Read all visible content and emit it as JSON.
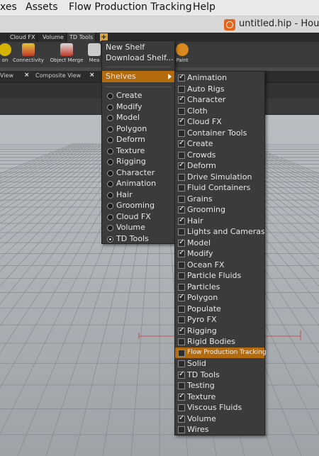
{
  "menubar": {
    "items": [
      "xes",
      "Assets",
      "Flow Production Tracking",
      "Help"
    ]
  },
  "window": {
    "title": "untitled.hip - Houc"
  },
  "shelf_tabs": [
    "",
    "Cloud FX",
    "Volume",
    "TD Tools",
    "+"
  ],
  "tools": [
    "on",
    "Connectivity",
    "Object Merge",
    "Mea",
    "Paint"
  ],
  "pane_tabs": [
    "View",
    "Composite View"
  ],
  "shelf_menu": {
    "new_shelf": "New Shelf",
    "download_shelf": "Download Shelf...",
    "shelves": "Shelves",
    "shelf_sets": [
      {
        "label": "Create",
        "selected": false
      },
      {
        "label": "Modify",
        "selected": false
      },
      {
        "label": "Model",
        "selected": false
      },
      {
        "label": "Polygon",
        "selected": false
      },
      {
        "label": "Deform",
        "selected": false
      },
      {
        "label": "Texture",
        "selected": false
      },
      {
        "label": "Rigging",
        "selected": false
      },
      {
        "label": "Character",
        "selected": false
      },
      {
        "label": "Animation",
        "selected": false
      },
      {
        "label": "Hair",
        "selected": false
      },
      {
        "label": "Grooming",
        "selected": false
      },
      {
        "label": "Cloud FX",
        "selected": false
      },
      {
        "label": "Volume",
        "selected": false
      },
      {
        "label": "TD Tools",
        "selected": true
      }
    ]
  },
  "shelves_submenu": [
    {
      "label": "Animation",
      "checked": true
    },
    {
      "label": "Auto Rigs",
      "checked": false
    },
    {
      "label": "Character",
      "checked": true
    },
    {
      "label": "Cloth",
      "checked": false
    },
    {
      "label": "Cloud FX",
      "checked": true
    },
    {
      "label": "Container Tools",
      "checked": false
    },
    {
      "label": "Create",
      "checked": true
    },
    {
      "label": "Crowds",
      "checked": false
    },
    {
      "label": "Deform",
      "checked": true
    },
    {
      "label": "Drive Simulation",
      "checked": false
    },
    {
      "label": "Fluid Containers",
      "checked": false
    },
    {
      "label": "Grains",
      "checked": false
    },
    {
      "label": "Grooming",
      "checked": true
    },
    {
      "label": "Hair",
      "checked": true
    },
    {
      "label": "Lights and Cameras",
      "checked": false
    },
    {
      "label": "Model",
      "checked": true
    },
    {
      "label": "Modify",
      "checked": true
    },
    {
      "label": "Ocean FX",
      "checked": false
    },
    {
      "label": "Particle Fluids",
      "checked": false
    },
    {
      "label": "Particles",
      "checked": false
    },
    {
      "label": "Polygon",
      "checked": true
    },
    {
      "label": "Populate",
      "checked": false
    },
    {
      "label": "Pyro FX",
      "checked": false
    },
    {
      "label": "Rigging",
      "checked": true
    },
    {
      "label": "Rigid Bodies",
      "checked": false
    },
    {
      "label": "Flow Production Tracking",
      "checked": false,
      "highlighted": true
    },
    {
      "label": "Solid",
      "checked": false
    },
    {
      "label": "TD Tools",
      "checked": true
    },
    {
      "label": "Testing",
      "checked": false
    },
    {
      "label": "Texture",
      "checked": true
    },
    {
      "label": "Viscous Fluids",
      "checked": false
    },
    {
      "label": "Volume",
      "checked": true
    },
    {
      "label": "Wires",
      "checked": false
    }
  ],
  "colors": {
    "highlight": "#b36b0e",
    "menu_bg": "#3b3b3b",
    "viewport_bg": "#a9aeb3"
  }
}
